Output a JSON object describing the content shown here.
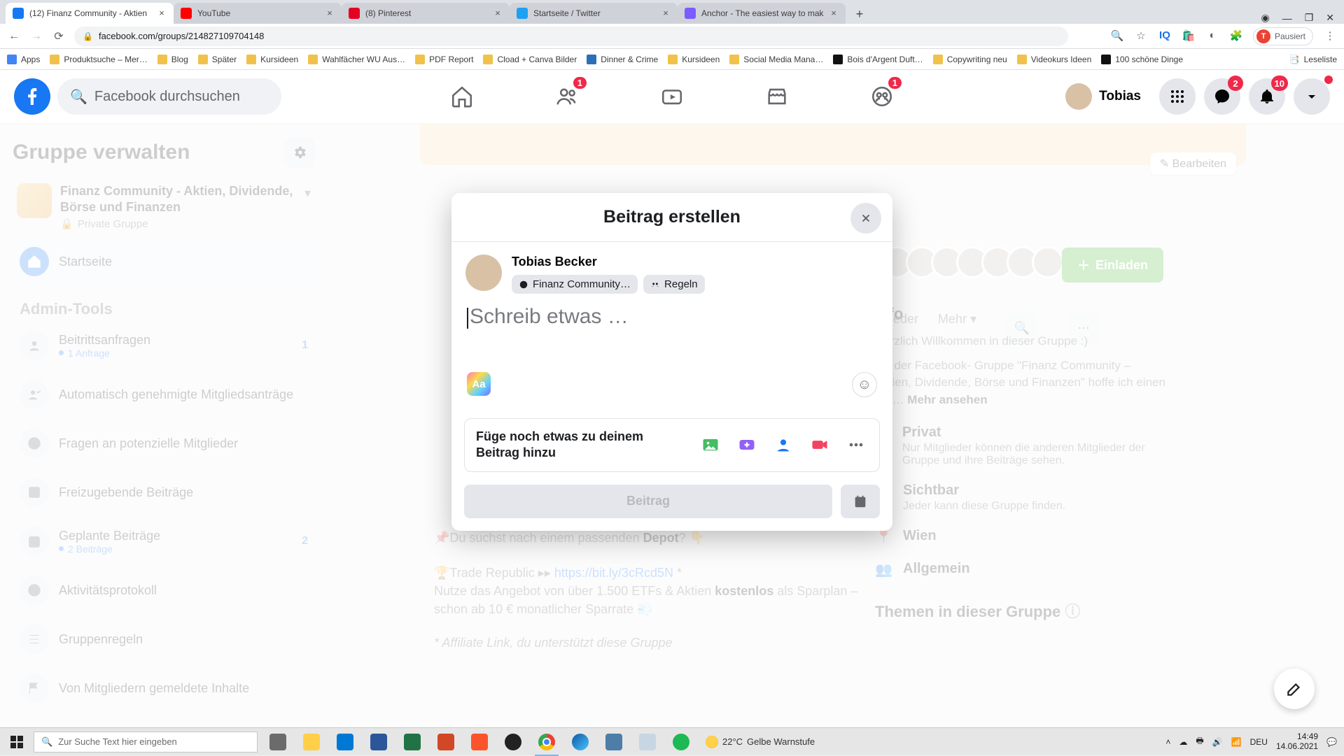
{
  "browser": {
    "tabs": [
      {
        "title": "(12) Finanz Community - Aktien",
        "favicon": "#1877f2"
      },
      {
        "title": "YouTube",
        "favicon": "#ff0000"
      },
      {
        "title": "(8) Pinterest",
        "favicon": "#e60023"
      },
      {
        "title": "Startseite / Twitter",
        "favicon": "#1da1f2"
      },
      {
        "title": "Anchor - The easiest way to mak",
        "favicon": "#7b5cff"
      }
    ],
    "url": "facebook.com/groups/214827109704148",
    "profile_state": "Pausiert",
    "profile_initial": "T",
    "bookmarks": [
      "Apps",
      "Produktsuche – Mer…",
      "Blog",
      "Später",
      "Kursideen",
      "Wahlfächer WU Aus…",
      "PDF Report",
      "Cload + Canva Bilder",
      "Dinner & Crime",
      "Kursideen",
      "Social Media Mana…",
      "Bois d'Argent Duft…",
      "Copywriting neu",
      "Videokurs Ideen",
      "100 schöne Dinge"
    ],
    "reading_list": "Leseliste"
  },
  "fb": {
    "search_placeholder": "Facebook durchsuchen",
    "nav_badge_friends": "1",
    "nav_badge_groups": "1",
    "profile_name": "Tobias",
    "messenger_badge": "2",
    "notif_badge": "10",
    "left": {
      "title": "Gruppe verwalten",
      "group_name": "Finanz Community - Aktien, Dividende, Börse und Finanzen",
      "group_privacy": "Private Gruppe",
      "home": "Startseite",
      "admin_header": "Admin-Tools",
      "items": [
        {
          "label": "Beitrittsanfragen",
          "count": "1",
          "sub": "1 Anfrage"
        },
        {
          "label": "Automatisch genehmigte Mitgliedsanträge"
        },
        {
          "label": "Fragen an potenzielle Mitglieder"
        },
        {
          "label": "Freizugebende Beiträge"
        },
        {
          "label": "Geplante Beiträge",
          "count": "2",
          "sub": "2 Beiträge"
        },
        {
          "label": "Aktivitätsprotokoll"
        },
        {
          "label": "Gruppenregeln"
        },
        {
          "label": "Von Mitgliedern gemeldete Inhalte"
        }
      ]
    },
    "main": {
      "edit_label": "Bearbeiten",
      "invite_label": "Einladen",
      "tabs_members": "…glieder",
      "tabs_more": "Mehr",
      "info": {
        "title": "Info",
        "welcome": "Herzlich Willkommen in dieser Gruppe :)",
        "desc": "Mit der Facebook- Gruppe \"Finanz Community – Aktien, Dividende, Börse und Finanzen\" hoffe ich einen ruh… ",
        "more": "Mehr ansehen",
        "privat_title": "Privat",
        "privat_desc": "Nur Mitglieder können die anderen Mitglieder der Gruppe und ihre Beiträge sehen.",
        "visible_title": "Sichtbar",
        "visible_desc": "Jeder kann diese Gruppe finden.",
        "location_title": "Wien",
        "general_title": "Allgemein",
        "topics_title": "Themen in dieser Gruppe"
      },
      "post": {
        "line1_pre": "📌Du suchst nach einem passenden ",
        "line1_bold": "Depot",
        "line1_post": "? 👇",
        "line2": "🏆Trade Republic ▸▸ ",
        "line2_link": "https://bit.ly/3cRcd5N",
        "line2_star": " *",
        "line3_pre": "Nutze das Angebot von über 1.500 ETFs & Aktien ",
        "line3_bold": "kostenlos",
        "line3_post": " als Sparplan – schon ab 10 € monatlicher Sparrate 💨",
        "aff": "* Affiliate Link, du unterstützt diese Gruppe"
      }
    },
    "modal": {
      "title": "Beitrag erstellen",
      "user_name": "Tobias Becker",
      "audience_group": "Finanz Community…",
      "audience_rules": "Regeln",
      "placeholder": "Schreib etwas …",
      "bg_letters": "Aa",
      "addto_label": "Füge noch etwas zu deinem Beitrag hinzu",
      "submit": "Beitrag"
    }
  },
  "taskbar": {
    "search_placeholder": "Zur Suche Text hier eingeben",
    "weather_temp": "22°C",
    "weather_text": "Gelbe Warnstufe",
    "lang": "DEU",
    "time": "14:49",
    "date": "14.06.2021"
  }
}
